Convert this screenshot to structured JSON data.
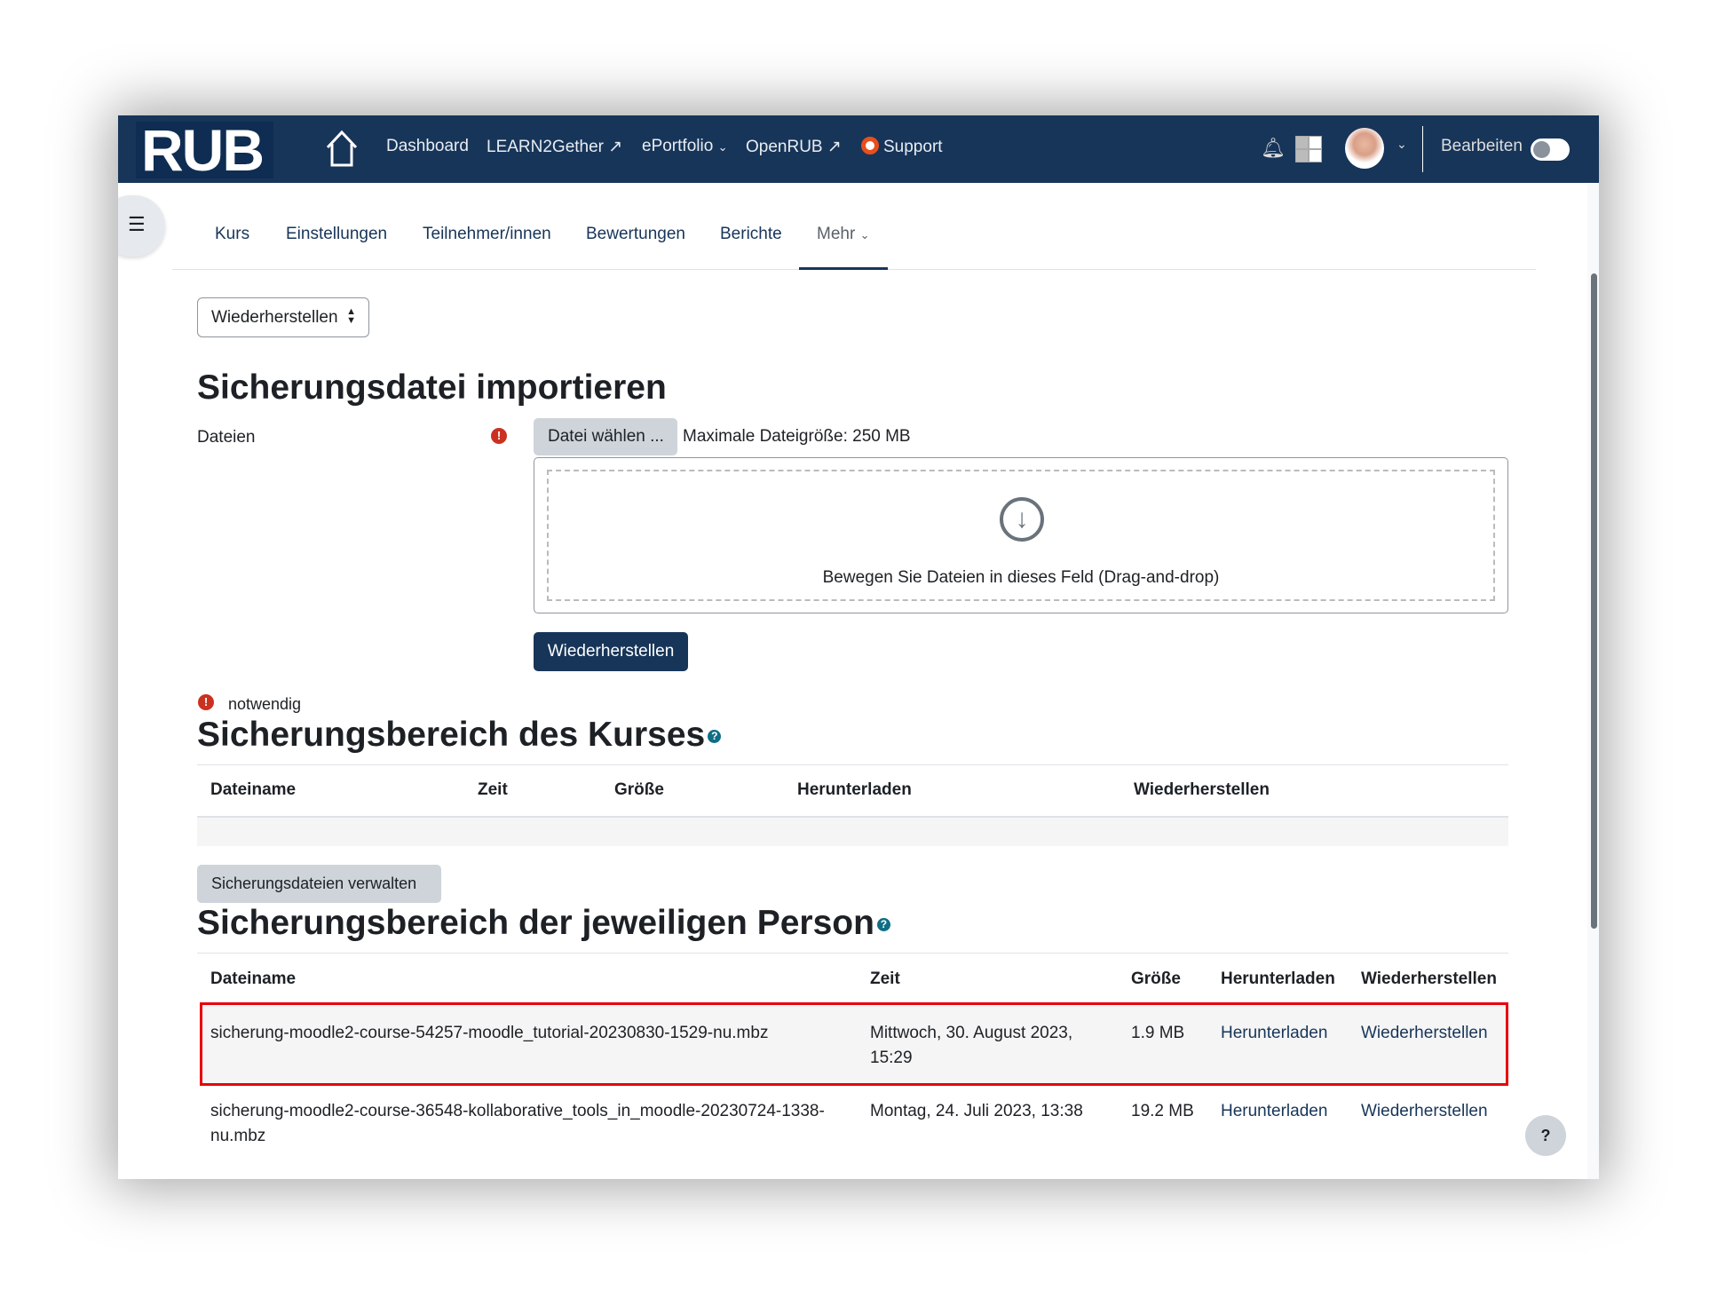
{
  "header": {
    "logo": "RUB",
    "nav": [
      {
        "label": "Dashboard"
      },
      {
        "label": "LEARN2Gether",
        "external": true
      },
      {
        "label": "ePortfolio",
        "dropdown": true
      },
      {
        "label": "OpenRUB",
        "external": true
      },
      {
        "label": "Support"
      }
    ],
    "edit_label": "Bearbeiten"
  },
  "secondary_nav": {
    "items": [
      "Kurs",
      "Einstellungen",
      "Teilnehmer/innen",
      "Bewertungen",
      "Berichte",
      "Mehr"
    ],
    "active": "Mehr"
  },
  "select": {
    "value": "Wiederherstellen"
  },
  "import": {
    "title": "Sicherungsdatei importieren",
    "files_label": "Dateien",
    "choose_button": "Datei wählen ...",
    "max_size": "Maximale Dateigröße: 250 MB",
    "drop_text": "Bewegen Sie Dateien in dieses Feld (Drag-and-drop)",
    "restore_button": "Wiederherstellen",
    "required_note": "notwendig"
  },
  "course_area": {
    "title": "Sicherungsbereich des Kurses",
    "columns": [
      "Dateiname",
      "Zeit",
      "Größe",
      "Herunterladen",
      "Wiederherstellen"
    ],
    "rows": [],
    "manage_button": "Sicherungsdateien verwalten"
  },
  "user_area": {
    "title": "Sicherungsbereich der jeweiligen Person",
    "columns": [
      "Dateiname",
      "Zeit",
      "Größe",
      "Herunterladen",
      "Wiederherstellen"
    ],
    "rows": [
      {
        "filename": "sicherung-moodle2-course-54257-moodle_tutorial-20230830-1529-nu.mbz",
        "time": "Mittwoch, 30. August 2023, 15:29",
        "size": "1.9 MB",
        "download": "Herunterladen",
        "restore": "Wiederherstellen",
        "highlighted": true
      },
      {
        "filename": "sicherung-moodle2-course-36548-kollaborative_tools_in_moodle-20230724-1338-nu.mbz",
        "time": "Montag, 24. Juli 2023, 13:38",
        "size": "19.2 MB",
        "download": "Herunterladen",
        "restore": "Wiederherstellen",
        "highlighted": false
      }
    ]
  },
  "help_button": "?",
  "colors": {
    "brand": "#173559",
    "highlight": "#e8000b",
    "error": "#ca3120"
  }
}
